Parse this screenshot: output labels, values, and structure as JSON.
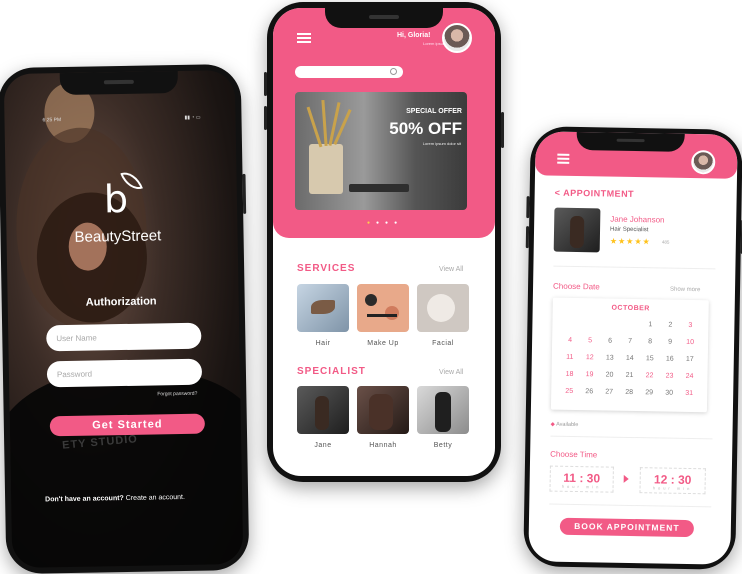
{
  "login": {
    "status_time": "6:25 PM",
    "brand_letter": "b",
    "brand_name": "BeautyStreet",
    "title": "Authorization",
    "username_placeholder": "User Name",
    "password_placeholder": "Password",
    "forgot": "Forgot password?",
    "cta": "Get Started",
    "signup_prefix": "Don't have an account?",
    "signup_link": "Create an account.",
    "background_text": "ETY STUDIO"
  },
  "home": {
    "greeting": "Hi, Gloria!",
    "greeting_sub": "Lorem ipsum",
    "banner": {
      "kicker": "SPECIAL OFFER",
      "headline": "50% OFF",
      "sub": "Lorem ipsum dolor sit"
    },
    "services_title": "SERVICES",
    "services_view_all": "View All",
    "services": [
      {
        "label": "Hair"
      },
      {
        "label": "Make Up"
      },
      {
        "label": "Facial"
      }
    ],
    "specialist_title": "SPECIALIST",
    "specialist_view_all": "View All",
    "specialists": [
      {
        "label": "Jane"
      },
      {
        "label": "Hannah"
      },
      {
        "label": "Betty"
      }
    ]
  },
  "appointment": {
    "back_title": "< APPOINTMENT",
    "name": "Jane Johanson",
    "role": "Hair Specialist",
    "rating_count": "485",
    "rating": 5,
    "choose_date": "Choose Date",
    "show_more": "Show more",
    "month": "OCTOBER",
    "calendar_rows": [
      [
        {
          "d": "",
          "h": false
        },
        {
          "d": "",
          "h": false
        },
        {
          "d": "",
          "h": false
        },
        {
          "d": "",
          "h": false
        },
        {
          "d": "1",
          "h": false
        },
        {
          "d": "2",
          "h": false
        },
        {
          "d": "3",
          "h": true
        }
      ],
      [
        {
          "d": "4",
          "h": true
        },
        {
          "d": "5",
          "h": true
        },
        {
          "d": "6",
          "h": false
        },
        {
          "d": "7",
          "h": false
        },
        {
          "d": "8",
          "h": false
        },
        {
          "d": "9",
          "h": false
        },
        {
          "d": "10",
          "h": true
        }
      ],
      [
        {
          "d": "11",
          "h": true
        },
        {
          "d": "12",
          "h": true
        },
        {
          "d": "13",
          "h": false
        },
        {
          "d": "14",
          "h": false
        },
        {
          "d": "15",
          "h": false
        },
        {
          "d": "16",
          "h": false
        },
        {
          "d": "17",
          "h": false
        }
      ],
      [
        {
          "d": "18",
          "h": true
        },
        {
          "d": "19",
          "h": true
        },
        {
          "d": "20",
          "h": false
        },
        {
          "d": "21",
          "h": false
        },
        {
          "d": "22",
          "h": true
        },
        {
          "d": "23",
          "h": true
        },
        {
          "d": "24",
          "h": true
        }
      ],
      [
        {
          "d": "25",
          "h": true
        },
        {
          "d": "26",
          "h": false
        },
        {
          "d": "27",
          "h": false
        },
        {
          "d": "28",
          "h": false
        },
        {
          "d": "29",
          "h": false
        },
        {
          "d": "30",
          "h": false
        },
        {
          "d": "31",
          "h": true
        }
      ]
    ],
    "available": "Available",
    "choose_time": "Choose Time",
    "time_from": {
      "h": "11",
      "m": "30",
      "sub": "hour min"
    },
    "time_to": {
      "h": "12",
      "m": "30",
      "sub": "hour min"
    },
    "cta": "BOOK APPOINTMENT"
  },
  "colors": {
    "accent": "#f25a86",
    "dark": "#111111"
  },
  "icons": [
    "menu-icon",
    "search-icon",
    "star-icon",
    "arrow-right-icon",
    "back-icon",
    "avatar"
  ]
}
